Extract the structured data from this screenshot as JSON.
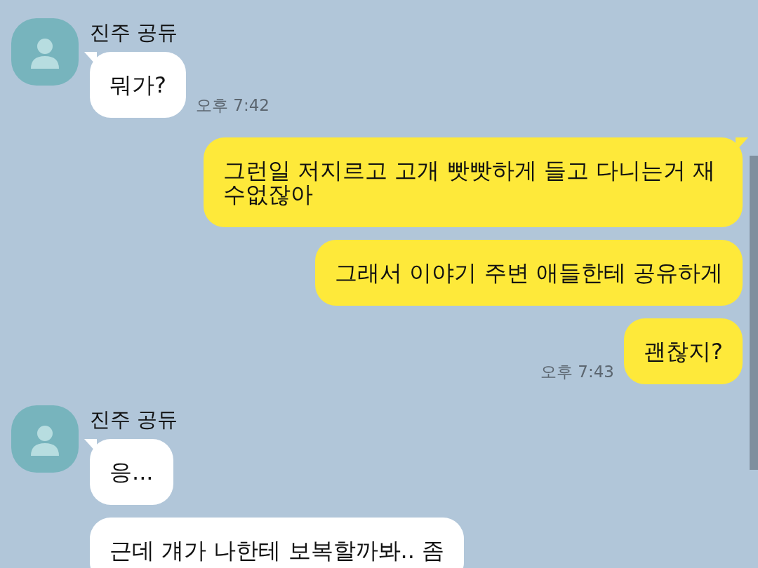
{
  "messages": [
    {
      "kind": "received",
      "sender": "진주 공듀",
      "bubbles": [
        "뭐가?"
      ],
      "time": "오후 7:42"
    },
    {
      "kind": "sent",
      "bubbles": [
        "그런일 저지르고 고개 빳빳하게 들고 다니는거 재수없잖아",
        "그래서 이야기 주변 애들한테 공유하게",
        "괜찮지?"
      ],
      "time": "오후 7:43"
    },
    {
      "kind": "received",
      "sender": "진주 공듀",
      "bubbles": [
        "응...",
        "근데 걔가 나한테 보복할까봐.. 좀"
      ]
    }
  ]
}
